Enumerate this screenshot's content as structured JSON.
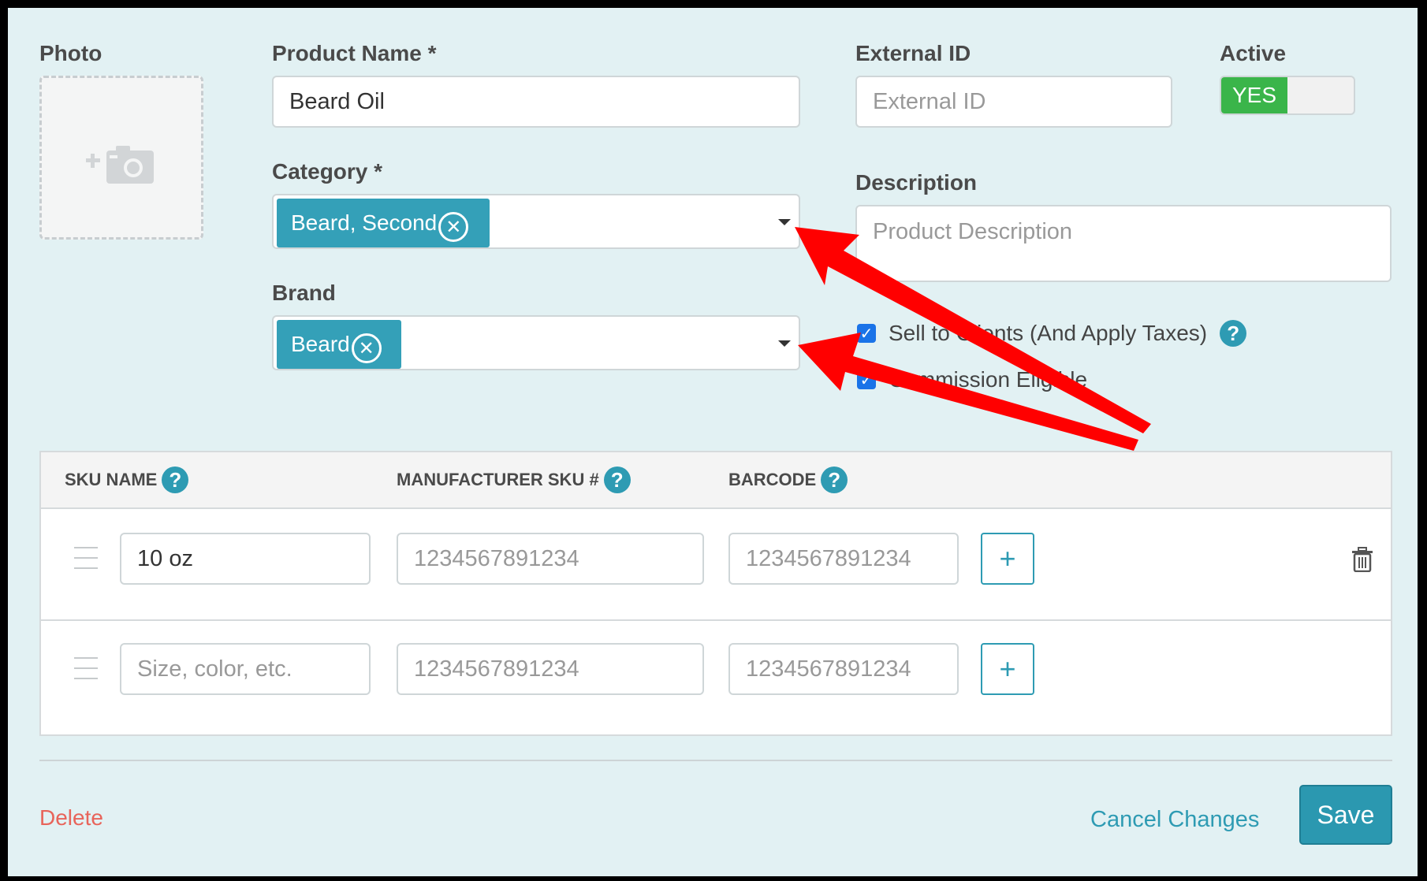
{
  "form": {
    "photo_label": "Photo",
    "product_name_label": "Product Name *",
    "product_name_value": "Beard Oil",
    "external_id_label": "External ID",
    "external_id_placeholder": "External ID",
    "active_label": "Active",
    "active_value": "YES",
    "category_label": "Category *",
    "category_tag": "Beard, Second",
    "description_label": "Description",
    "description_placeholder": "Product Description",
    "brand_label": "Brand",
    "brand_tag": "Beard",
    "sell_to_clients_label": "Sell to Clients (And Apply Taxes)",
    "commission_label": "Commission Eligible"
  },
  "sku_table": {
    "headers": [
      "SKU NAME",
      "MANUFACTURER SKU #",
      "BARCODE"
    ],
    "rows": [
      {
        "sku_name": "10 oz",
        "sku_name_placeholder": "",
        "manufacturer_placeholder": "1234567891234",
        "barcode_placeholder": "1234567891234"
      },
      {
        "sku_name": "",
        "sku_name_placeholder": "Size, color, etc.",
        "manufacturer_placeholder": "1234567891234",
        "barcode_placeholder": "1234567891234"
      }
    ]
  },
  "footer": {
    "delete_label": "Delete",
    "cancel_label": "Cancel Changes",
    "save_label": "Save"
  },
  "colors": {
    "accent": "#2e9bb3",
    "toggle_on": "#3ab54a",
    "delete": "#e8645a",
    "annotation_arrow": "#ff0000"
  }
}
